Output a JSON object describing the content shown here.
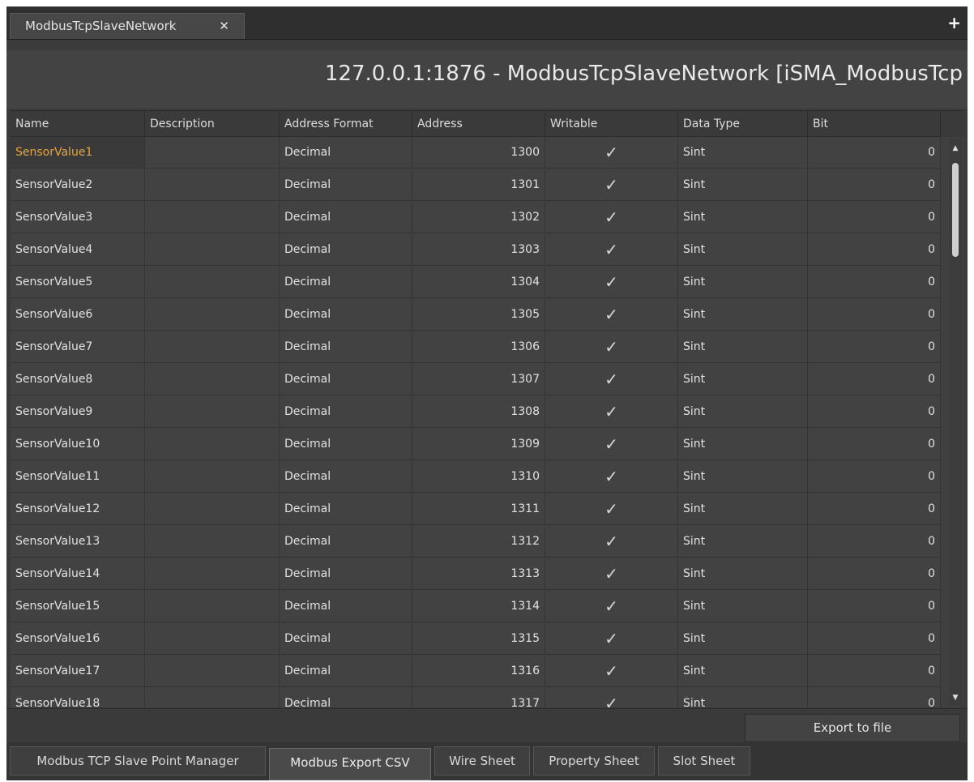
{
  "doc_tab": {
    "label": "ModbusTcpSlaveNetwork",
    "close": "✕"
  },
  "add_tab": "+",
  "header": {
    "title": "127.0.0.1:1876 - ModbusTcpSlaveNetwork [iSMA_ModbusTcp"
  },
  "columns": [
    "Name",
    "Description",
    "Address Format",
    "Address",
    "Writable",
    "Data Type",
    "Bit"
  ],
  "rows": [
    {
      "name": "SensorValue1",
      "description": "",
      "format": "Decimal",
      "address": "1300",
      "writable": "✓",
      "type": "Sint",
      "bit": "0"
    },
    {
      "name": "SensorValue2",
      "description": "",
      "format": "Decimal",
      "address": "1301",
      "writable": "✓",
      "type": "Sint",
      "bit": "0"
    },
    {
      "name": "SensorValue3",
      "description": "",
      "format": "Decimal",
      "address": "1302",
      "writable": "✓",
      "type": "Sint",
      "bit": "0"
    },
    {
      "name": "SensorValue4",
      "description": "",
      "format": "Decimal",
      "address": "1303",
      "writable": "✓",
      "type": "Sint",
      "bit": "0"
    },
    {
      "name": "SensorValue5",
      "description": "",
      "format": "Decimal",
      "address": "1304",
      "writable": "✓",
      "type": "Sint",
      "bit": "0"
    },
    {
      "name": "SensorValue6",
      "description": "",
      "format": "Decimal",
      "address": "1305",
      "writable": "✓",
      "type": "Sint",
      "bit": "0"
    },
    {
      "name": "SensorValue7",
      "description": "",
      "format": "Decimal",
      "address": "1306",
      "writable": "✓",
      "type": "Sint",
      "bit": "0"
    },
    {
      "name": "SensorValue8",
      "description": "",
      "format": "Decimal",
      "address": "1307",
      "writable": "✓",
      "type": "Sint",
      "bit": "0"
    },
    {
      "name": "SensorValue9",
      "description": "",
      "format": "Decimal",
      "address": "1308",
      "writable": "✓",
      "type": "Sint",
      "bit": "0"
    },
    {
      "name": "SensorValue10",
      "description": "",
      "format": "Decimal",
      "address": "1309",
      "writable": "✓",
      "type": "Sint",
      "bit": "0"
    },
    {
      "name": "SensorValue11",
      "description": "",
      "format": "Decimal",
      "address": "1310",
      "writable": "✓",
      "type": "Sint",
      "bit": "0"
    },
    {
      "name": "SensorValue12",
      "description": "",
      "format": "Decimal",
      "address": "1311",
      "writable": "✓",
      "type": "Sint",
      "bit": "0"
    },
    {
      "name": "SensorValue13",
      "description": "",
      "format": "Decimal",
      "address": "1312",
      "writable": "✓",
      "type": "Sint",
      "bit": "0"
    },
    {
      "name": "SensorValue14",
      "description": "",
      "format": "Decimal",
      "address": "1313",
      "writable": "✓",
      "type": "Sint",
      "bit": "0"
    },
    {
      "name": "SensorValue15",
      "description": "",
      "format": "Decimal",
      "address": "1314",
      "writable": "✓",
      "type": "Sint",
      "bit": "0"
    },
    {
      "name": "SensorValue16",
      "description": "",
      "format": "Decimal",
      "address": "1315",
      "writable": "✓",
      "type": "Sint",
      "bit": "0"
    },
    {
      "name": "SensorValue17",
      "description": "",
      "format": "Decimal",
      "address": "1316",
      "writable": "✓",
      "type": "Sint",
      "bit": "0"
    },
    {
      "name": "SensorValue18",
      "description": "",
      "format": "Decimal",
      "address": "1317",
      "writable": "✓",
      "type": "Sint",
      "bit": "0"
    }
  ],
  "scroll": {
    "up": "▲",
    "down": "▼"
  },
  "footer": {
    "export_label": "Export to file"
  },
  "bottom_tabs": [
    "Modbus TCP Slave Point Manager",
    "Modbus Export CSV",
    "Wire Sheet",
    "Property Sheet",
    "Slot Sheet"
  ],
  "colors": {
    "selected_text": "#e9a43a",
    "background": "#3b3b3b"
  }
}
